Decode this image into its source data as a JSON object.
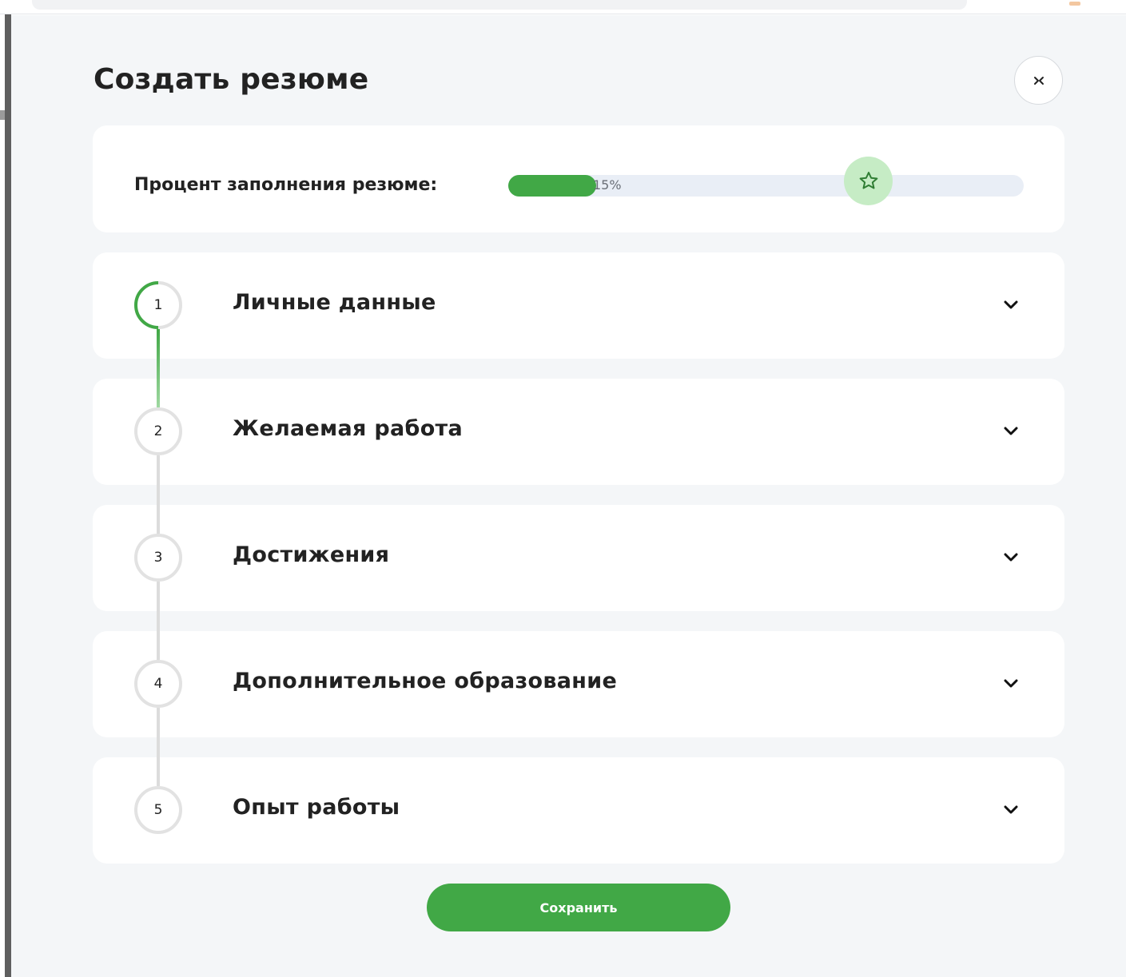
{
  "modal": {
    "title": "Создать резюме"
  },
  "progress": {
    "label": "Процент заполнения резюме:",
    "value_text": "15%",
    "value_percent": 15
  },
  "steps": [
    {
      "number": "1",
      "title": "Личные данные",
      "active": true
    },
    {
      "number": "2",
      "title": "Желаемая работа",
      "active": false
    },
    {
      "number": "3",
      "title": "Достижения",
      "active": false
    },
    {
      "number": "4",
      "title": "Дополнительное образование",
      "active": false
    },
    {
      "number": "5",
      "title": "Опыт работы",
      "active": false
    }
  ],
  "actions": {
    "save_label": "Сохранить"
  },
  "icons": {
    "close": "close-icon",
    "star": "star-icon",
    "chevron": "chevron-down-icon"
  },
  "colors": {
    "accent": "#41a846",
    "accent_light": "#c6ecc5",
    "track": "#e9eef6",
    "background": "#f4f6f8"
  }
}
